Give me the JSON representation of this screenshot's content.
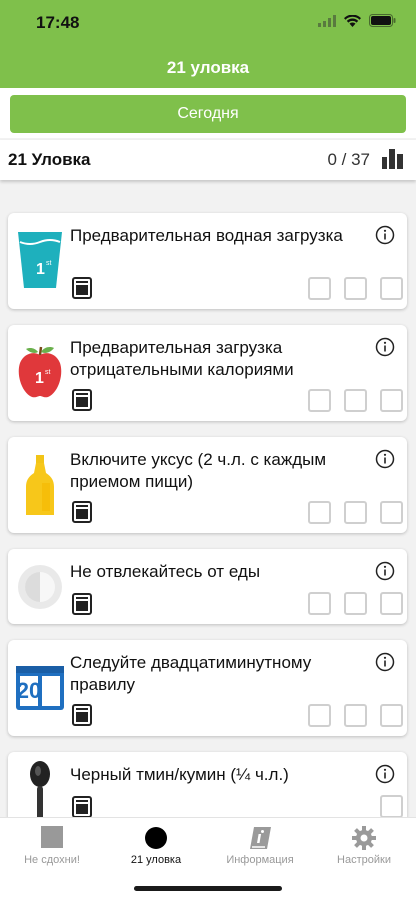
{
  "status_bar": {
    "time": "17:48"
  },
  "header": {
    "title": "21 уловка"
  },
  "today_button": {
    "label": "Сегодня"
  },
  "summary": {
    "title": "21 Уловка",
    "count": "0 / 37"
  },
  "colors": {
    "accent": "#7fc04b",
    "checkbox_border": "#cfcfcf"
  },
  "items": [
    {
      "icon": "water-glass-icon",
      "text": "Предварительная водная загрузка",
      "checkboxes": 3
    },
    {
      "icon": "apple-icon",
      "text": "Предварительная загрузка отрицательными калориями",
      "checkboxes": 3
    },
    {
      "icon": "vinegar-bottle-icon",
      "text": "Включите уксус (2 ч.л. с каждым приемом пищи)",
      "checkboxes": 3
    },
    {
      "icon": "plate-icon",
      "text": "Не отвлекайтесь от еды",
      "checkboxes": 3
    },
    {
      "icon": "twenty-icon",
      "text": "Следуйте двадцатиминутному правилу",
      "checkboxes": 3,
      "badge": "20"
    },
    {
      "icon": "spoon-icon",
      "text": "Черный тмин/кумин (¼ ч.л.)",
      "checkboxes": 1
    }
  ],
  "tabs": [
    {
      "label": "Не сдохни!",
      "icon": "square-icon",
      "active": false
    },
    {
      "label": "21 уловка",
      "icon": "circle-icon",
      "active": true
    },
    {
      "label": "Информация",
      "icon": "info-book-icon",
      "active": false
    },
    {
      "label": "Настройки",
      "icon": "gear-icon",
      "active": false
    }
  ]
}
